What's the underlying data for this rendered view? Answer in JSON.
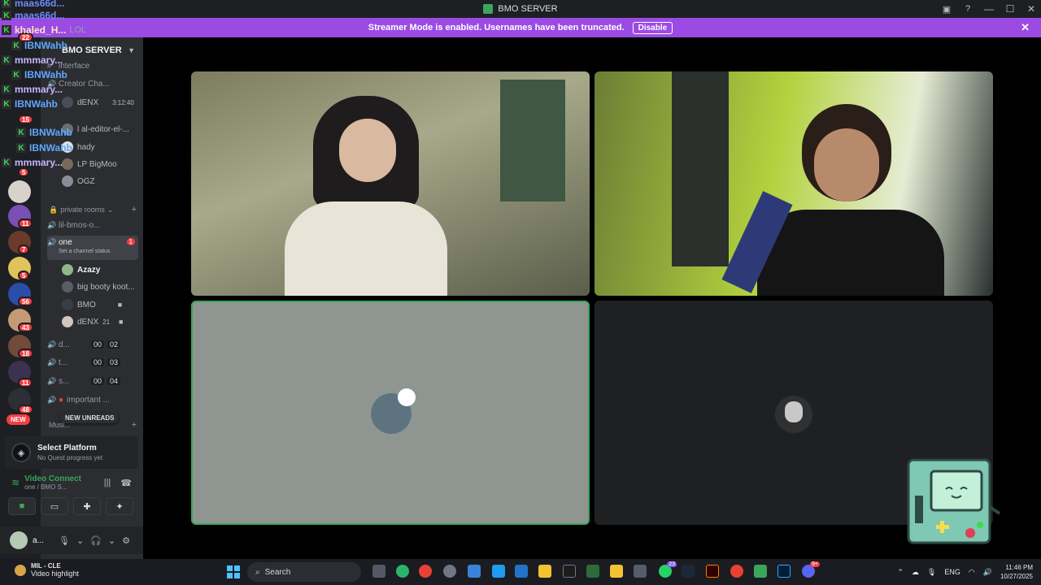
{
  "window": {
    "title": "BMO SERVER",
    "controls": [
      "—",
      "☐",
      "✕"
    ]
  },
  "banner": {
    "text": "Streamer Mode is enabled. Usernames have been truncated.",
    "disable_label": "Disable"
  },
  "overlay_chat": [
    {
      "name": "maas66d...",
      "msg": "",
      "color": "c1"
    },
    {
      "name": "maas66d...",
      "msg": "",
      "color": "c1"
    },
    {
      "name": "khaled_H...",
      "msg": "LOL",
      "color": "c4"
    },
    {
      "name": "IBNWahb",
      "msg": "",
      "color": "c3"
    },
    {
      "name": "mmmary...",
      "msg": "",
      "color": "c2"
    },
    {
      "name": "IBNWahb",
      "msg": "",
      "color": "c3"
    },
    {
      "name": "mmmary...",
      "msg": "",
      "color": "c2"
    },
    {
      "name": "IBNWahb",
      "msg": "",
      "color": "c3"
    },
    {
      "name": "IBNWahb",
      "msg": "",
      "color": "c3"
    },
    {
      "name": "IBNWahb",
      "msg": "",
      "color": "c3"
    },
    {
      "name": "mmmary...",
      "msg": "",
      "color": "c2"
    }
  ],
  "server_badges": [
    "22",
    "15",
    "5",
    "11",
    "7",
    "5",
    "56",
    "43",
    "18",
    "11",
    "48"
  ],
  "server_new_label": "NEW",
  "sidebar": {
    "server_name": "BMO SERVER",
    "channels_top": [
      {
        "label": "interface"
      },
      {
        "label": "Creator Cha..."
      }
    ],
    "users_top": [
      {
        "name": "dENX",
        "extra": "3:12:40"
      },
      {
        "name": "l al-editor-el-...",
        "extra": ""
      },
      {
        "name": "hady",
        "extra": ""
      },
      {
        "name": "LP BigMoo",
        "extra": ""
      },
      {
        "name": "OGZ",
        "extra": ""
      }
    ],
    "category_private": "private rooms",
    "channel_bmos": "lil-bmos-o...",
    "channel_one": "one",
    "channel_one_badge": "1",
    "channel_one_status": "Set a channel status",
    "users_one": [
      {
        "name": "Azazy",
        "extra": ""
      },
      {
        "name": "big booty koot...",
        "extra": ""
      },
      {
        "name": "BMO",
        "extra": ""
      },
      {
        "name": "dENX",
        "extra": "21"
      }
    ],
    "channels_bottom": [
      {
        "label": "d...",
        "c1": "00",
        "c2": "02"
      },
      {
        "label": "t...",
        "c1": "00",
        "c2": "03"
      },
      {
        "label": "s...",
        "c1": "00",
        "c2": "04"
      },
      {
        "label": "important ...",
        "c1": "",
        "c2": ""
      }
    ],
    "new_unreads": "NEW UNREADS",
    "category_music": "Musi..."
  },
  "quest": {
    "title": "Select Platform",
    "subtitle": "No Quest progress yet"
  },
  "voice": {
    "status": "Video Connecte...",
    "channel": "one / BMO S..."
  },
  "user_panel": {
    "name": "a..."
  },
  "taskbar": {
    "weather_title": "MIL - CLE",
    "weather_sub": "Video highlight",
    "search_placeholder": "Search",
    "lang": "ENG",
    "time": "11:46 PM",
    "date": "10/27/2025",
    "app_badge_1": "23",
    "app_badge_2": "9+"
  },
  "colors": {
    "accent": "#9b4be4",
    "connected": "#3ba55c",
    "badge": "#f23f43"
  }
}
